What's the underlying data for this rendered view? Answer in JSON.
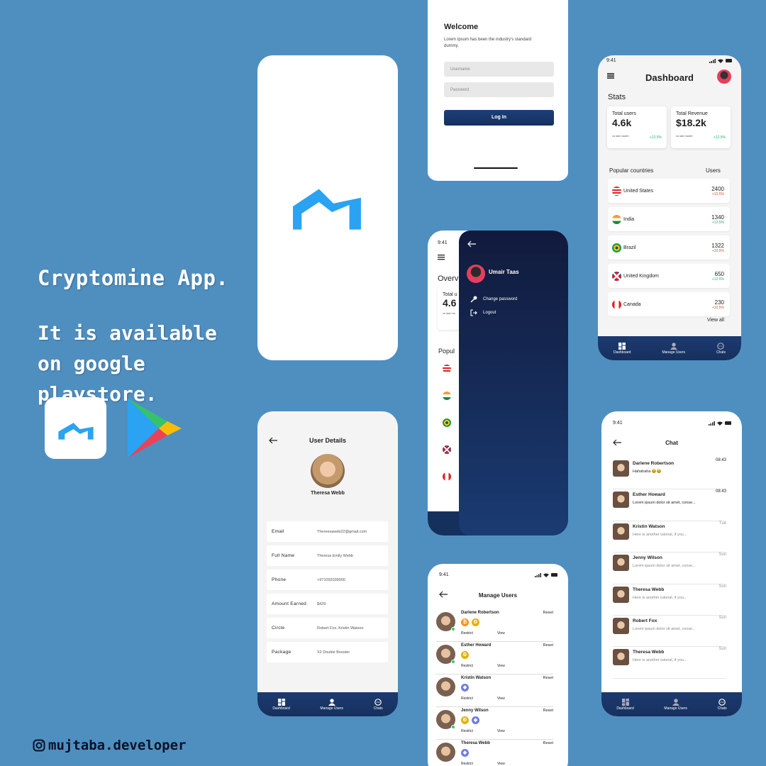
{
  "promo": {
    "title": "Cryptomine  App.",
    "subtitle": "It is available on google playstore.",
    "handle": "mujtaba.developer"
  },
  "colors": {
    "background": "#4f8fc0",
    "accent": "#2aa3f2",
    "navy": "#16305e"
  },
  "login": {
    "title": "Welcome",
    "desc": "Lorem Ipsum has been the industry's standard dummy.",
    "username_placeholder": "Username",
    "password_placeholder": "Password",
    "button": "Log In"
  },
  "dashboard": {
    "time": "9:41",
    "title": "Dashboard",
    "stats_label": "Stats",
    "stats": [
      {
        "label": "Total users",
        "value": "4.6k",
        "caption": "vs last month",
        "change": "+12.5%"
      },
      {
        "label": "Total Revenue",
        "value": "$18.2k",
        "caption": "vs last month",
        "change": "+12.5%"
      }
    ],
    "countries_label": "Popular countries",
    "users_label": "Users",
    "countries": [
      {
        "name": "United States",
        "value": "2400",
        "change": "+10.5%",
        "trend": "down"
      },
      {
        "name": "India",
        "value": "1340",
        "change": "+12.5%",
        "trend": "up"
      },
      {
        "name": "Brazil",
        "value": "1322",
        "change": "+10.5%",
        "trend": "down"
      },
      {
        "name": "United Kingdom",
        "value": "650",
        "change": "+12.5%",
        "trend": "up"
      },
      {
        "name": "Canada",
        "value": "230",
        "change": "+10.5%",
        "trend": "down"
      }
    ],
    "view_all": "View all"
  },
  "tabs": {
    "dashboard": "Dashboard",
    "manage": "Manage Users",
    "chats": "Chats"
  },
  "drawer": {
    "time": "9:41",
    "overview": "Overv",
    "total": "Total u",
    "value": "4.6",
    "caption": "vs last mo",
    "popular": "Popul",
    "user": "Umair Taas",
    "menu": [
      "Change password",
      "Logout"
    ]
  },
  "user_details": {
    "title": "User Details",
    "name": "Theresa Webb",
    "fields": [
      {
        "label": "Email",
        "value": "Thereesaweb22@gmail.com"
      },
      {
        "label": "Full Name",
        "value": "Theresa Emily Webb"
      },
      {
        "label": "Phone",
        "value": "+971092039000"
      },
      {
        "label": "Amount Earned",
        "value": "$429"
      },
      {
        "label": "Circle",
        "value": "Robert Fox, Kristin Watson"
      },
      {
        "label": "Package",
        "value": "X2 Double Booster"
      }
    ]
  },
  "manage_users": {
    "time": "9:41",
    "title": "Manage Users",
    "reset": "Reset",
    "restrict": "Restrict",
    "view": "View",
    "users": [
      {
        "name": "Darlene Robertson",
        "coins": [
          "btc",
          "doge"
        ],
        "online": true
      },
      {
        "name": "Esther Howard",
        "coins": [
          "doge"
        ],
        "online": true
      },
      {
        "name": "Kristin Watson",
        "coins": [
          "eth"
        ],
        "online": false
      },
      {
        "name": "Jenny Wilson",
        "coins": [
          "doge",
          "eth"
        ],
        "online": true
      },
      {
        "name": "Theresa Webb",
        "coins": [
          "eth"
        ],
        "online": false
      }
    ]
  },
  "chat": {
    "time": "9:41",
    "title": "Chat",
    "items": [
      {
        "name": "Darlene Robertson",
        "message": "Hahahaha 😂😂",
        "time": "08:43"
      },
      {
        "name": "Esther Howard",
        "message": "Lorem ipsum dolor sit amet, conse...",
        "time": "08:43"
      },
      {
        "name": "Kristin Watson",
        "message": "Here is another tutorial, if you...",
        "time": "Tue"
      },
      {
        "name": "Jenny Wilson",
        "message": "Lorem ipsum dolor sit amet, conse...",
        "time": "Sun"
      },
      {
        "name": "Theresa Webb",
        "message": "Here is another tutorial, if you...",
        "time": "Sun"
      },
      {
        "name": "Robert Fox",
        "message": "Lorem ipsum dolor sit amet, conse...",
        "time": "Sun"
      },
      {
        "name": "Theresa Webb",
        "message": "Here is another tutorial, if you...",
        "time": "Sun"
      }
    ]
  }
}
